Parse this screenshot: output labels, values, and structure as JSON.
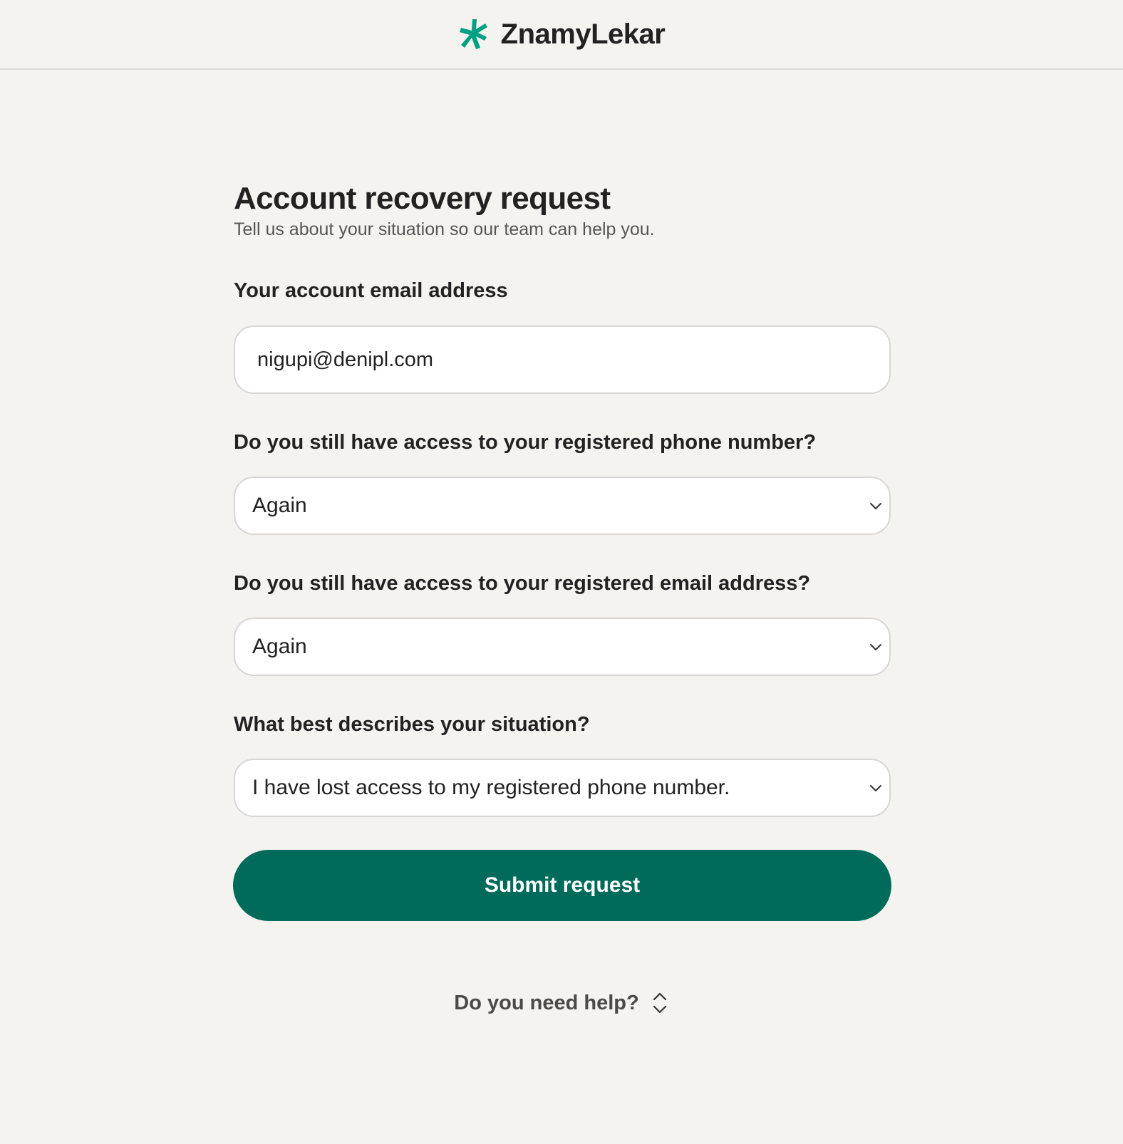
{
  "brand": {
    "name": "ZnamyLekar",
    "logo_icon": "star-cross-logo-icon",
    "logo_color": "#00a083"
  },
  "form": {
    "title": "Account recovery request",
    "subtitle": "Tell us about your situation so our team can help you.",
    "email": {
      "label": "Your account email address",
      "value": "nigupi@denipl.com"
    },
    "phone_access": {
      "label": "Do you still have access to your registered phone number?",
      "selected": "Again"
    },
    "email_access": {
      "label": "Do you still have access to your registered email address?",
      "selected": "Again"
    },
    "situation": {
      "label": "What best describes your situation?",
      "selected": "I have lost access to my registered phone number."
    },
    "submit_label": "Submit request"
  },
  "help": {
    "label": "Do you need help?",
    "icon": "chevron-up-down-icon"
  },
  "colors": {
    "accent": "#006b5a",
    "background": "#f5f3f0"
  }
}
